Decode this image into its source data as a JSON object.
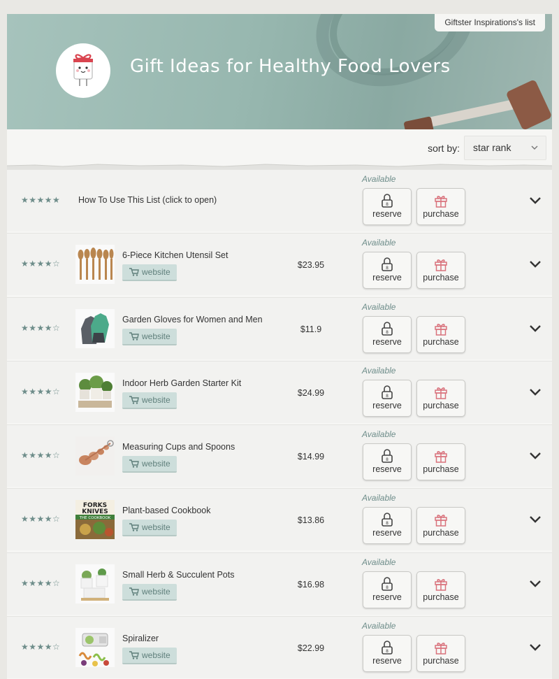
{
  "header": {
    "owner_tab": "Giftster Inspirations's list",
    "title": "Gift Ideas for Healthy Food Lovers"
  },
  "sort": {
    "label": "sort by:",
    "selected": "star rank"
  },
  "colors": {
    "accent": "#6e8d8a",
    "banner": "#97b7af",
    "gift_icon": "#d9727c"
  },
  "help_row": {
    "stars": "★★★★★",
    "label": "How To Use This List (click to open)",
    "status": "Available",
    "reserve": "reserve",
    "purchase": "purchase"
  },
  "items": [
    {
      "stars": "★★★★☆",
      "name": "6-Piece Kitchen Utensil Set",
      "website": "website",
      "price": "$23.95",
      "status": "Available",
      "reserve": "reserve",
      "purchase": "purchase",
      "rating": 4
    },
    {
      "stars": "★★★★☆",
      "name": "Garden Gloves for Women and Men",
      "website": "website",
      "price": "$11.9",
      "status": "Available",
      "reserve": "reserve",
      "purchase": "purchase",
      "rating": 4
    },
    {
      "stars": "★★★★☆",
      "name": "Indoor Herb Garden Starter Kit",
      "website": "website",
      "price": "$24.99",
      "status": "Available",
      "reserve": "reserve",
      "purchase": "purchase",
      "rating": 4
    },
    {
      "stars": "★★★★☆",
      "name": "Measuring Cups and Spoons",
      "website": "website",
      "price": "$14.99",
      "status": "Available",
      "reserve": "reserve",
      "purchase": "purchase",
      "rating": 4
    },
    {
      "stars": "★★★★☆",
      "name": "Plant-based Cookbook",
      "website": "website",
      "price": "$13.86",
      "status": "Available",
      "reserve": "reserve",
      "purchase": "purchase",
      "rating": 4
    },
    {
      "stars": "★★★★☆",
      "name": "Small Herb & Succulent Pots",
      "website": "website",
      "price": "$16.98",
      "status": "Available",
      "reserve": "reserve",
      "purchase": "purchase",
      "rating": 4
    },
    {
      "stars": "★★★★☆",
      "name": "Spiralizer",
      "website": "website",
      "price": "$22.99",
      "status": "Available",
      "reserve": "reserve",
      "purchase": "purchase",
      "rating": 4
    }
  ],
  "cookbook_cover": {
    "top": "FORKS",
    "mid": "KNIVES",
    "sub": "THE COOKBOOK"
  }
}
